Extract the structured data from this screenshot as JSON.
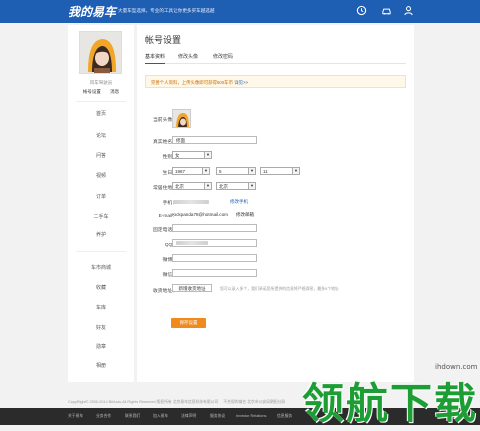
{
  "header": {
    "logo": "我的易车",
    "slogan": "大量车型选择，专业的工具让你更多买车越选越",
    "icons": [
      "clock-icon",
      "car-icon",
      "user-icon"
    ]
  },
  "sidebar": {
    "username": "风车驾驶员",
    "links": [
      "帐号设置",
      "消息"
    ],
    "nav_group1": [
      "首页",
      "论坛",
      "问答",
      "视频",
      "订单",
      "二手车",
      "养护"
    ],
    "nav_group2": [
      "车市商城",
      "收藏",
      "车库",
      "好友",
      "勋章",
      "相册"
    ]
  },
  "main": {
    "title": "帐号设置",
    "tabs": [
      "基本资料",
      "修改头像",
      "修改密码"
    ],
    "notice": "完善个人资料，上传头像即可获得500车币",
    "notice_link": "详见>>",
    "labels": {
      "avatar": "当前头像：",
      "realname": "真实姓名：",
      "gender": "性别：",
      "birthday": "生日：",
      "region": "常居住地：",
      "phone": "手机：",
      "email": "E-mail：",
      "tel": "固定电话：",
      "qq": "QQ：",
      "weibo": "微博：",
      "wechat": "微信：",
      "address": "收货地址："
    },
    "values": {
      "realname": "修面",
      "gender": "女",
      "birth_year": "1987",
      "birth_month": "5",
      "birth_day": "11",
      "province": "北京",
      "city": "北京",
      "email": "rockpanda78@hotmail.com"
    },
    "links": {
      "modify_phone": "修改手机",
      "modify_email": "修改邮箱",
      "manage_address": "新增收货地址"
    },
    "address_hint": "您可以录入多个，我们承诺您所提供的信息将严格保密，最多5个地址",
    "save_button": "保存设置"
  },
  "footer": {
    "copyright": "CopyRight© 2000-2014 BitAuto,All Rights Reserved 版权所有 北京易车信息科技有限公司",
    "copyright_extra": "不合规的域名 北京市公安局朝阳分局",
    "nav": [
      "关于易车",
      "业务合作",
      "联系我们",
      "加入易车",
      "法律声明",
      "服务协议",
      "Investor Relations",
      "信息服务"
    ]
  },
  "watermark": {
    "url": "ihdown.com",
    "text": "领航下载"
  }
}
